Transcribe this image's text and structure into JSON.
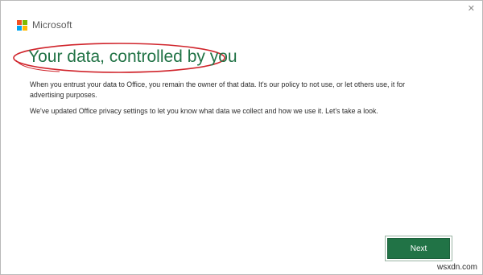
{
  "window": {
    "close_glyph": "✕"
  },
  "brand": {
    "name": "Microsoft",
    "logo_colors": [
      "#f25022",
      "#7fba00",
      "#00a4ef",
      "#ffb900"
    ]
  },
  "title": "Your data, controlled by you",
  "paragraphs": [
    "When you entrust your data to Office, you remain the owner of that data. It's our policy to not use, or let others use, it for advertising purposes.",
    "We've updated Office privacy settings to let you know what data we collect and how we use it. Let's take a look."
  ],
  "next_button": "Next",
  "watermark": "wsxdn.com",
  "colors": {
    "accent": "#217346",
    "annotation": "#d0242b"
  }
}
